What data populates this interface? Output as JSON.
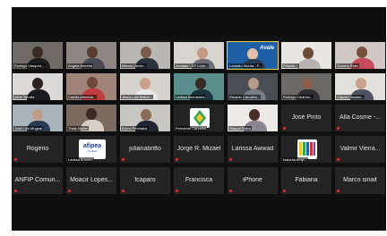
{
  "gallery": {
    "row1": [
      {
        "name": "Rodrigo Vásquez..."
      },
      {
        "name": "Angela Moreira"
      },
      {
        "name": "Márcio (Ambr..."
      },
      {
        "name": "Jonatan - SP Loan..."
      },
      {
        "name": "Leandro Moura - F...",
        "logo_text": "Avale"
      },
      {
        "name": "Priscila ..."
      },
      {
        "name": "Suzana Rider"
      }
    ],
    "row2": [
      {
        "name": "Aline Tarrafa"
      },
      {
        "name": "Camila Almeida..."
      },
      {
        "name": "Jesus Luiz Brand..."
      },
      {
        "name": "Larissa Bernardes"
      },
      {
        "name": "Ricardo Carvalho..."
      },
      {
        "name": "Rodrigo Carlinho..."
      },
      {
        "name": "Cláudio Santos..."
      }
    ],
    "row3": [
      {
        "name": "José Luiz Mugnai"
      },
      {
        "name": "Thais Nader"
      },
      {
        "name": "Bruno Fechador"
      },
      {
        "name": "Fernando Carvalho"
      },
      {
        "name": "Raquel Durra"
      },
      {
        "name": "José Pinto"
      },
      {
        "name": "Alla Cosme -..."
      }
    ],
    "row4": [
      {
        "name": "Rogério"
      },
      {
        "name": "Larissa Amorim",
        "logo_text": "afipea",
        "logo_sub": "sindical"
      },
      {
        "name": "julianabritto"
      },
      {
        "name": "Jorge R. Mizael"
      },
      {
        "name": "Larissa Awwad"
      },
      {
        "name": "Isabella Amyr..."
      },
      {
        "name": "Valmir Vieira..."
      }
    ],
    "row5": [
      {
        "name": "ANFIP Comun..."
      },
      {
        "name": "Moacir Lopes..."
      },
      {
        "name": "fcaparo"
      },
      {
        "name": "Francisca"
      },
      {
        "name": "iPhone"
      },
      {
        "name": "Fabiana"
      },
      {
        "name": "Marco sinait"
      }
    ]
  },
  "colors": {
    "active_border": "#f2d22e",
    "tile_bg": "#242424",
    "muted_icon": "#d3302f"
  }
}
